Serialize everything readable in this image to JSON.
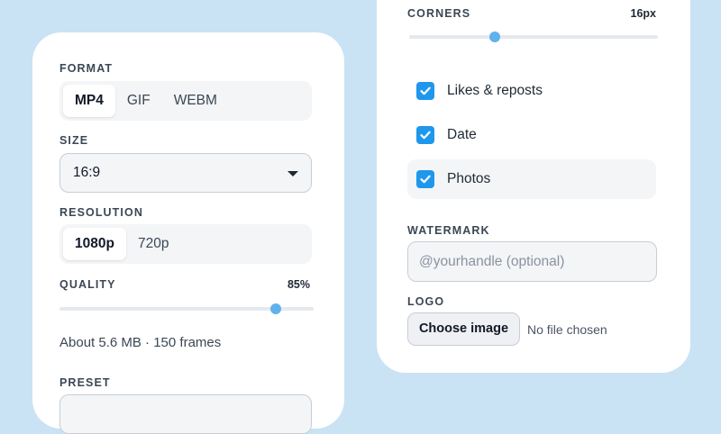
{
  "export_panel": {
    "format": {
      "label": "FORMAT",
      "options": [
        "MP4",
        "GIF",
        "WEBM"
      ],
      "selected": "MP4"
    },
    "size": {
      "label": "SIZE",
      "value": "16:9"
    },
    "resolution": {
      "label": "RESOLUTION",
      "options": [
        "1080p",
        "720p"
      ],
      "selected": "1080p"
    },
    "quality": {
      "label": "QUALITY",
      "value_text": "85%",
      "value": 0.85
    },
    "estimate": "About 5.6 MB · 150 frames",
    "preset": {
      "label": "PRESET"
    }
  },
  "style_panel": {
    "corners": {
      "label": "CORNERS",
      "value_text": "16px",
      "value": 16
    },
    "toggles": [
      {
        "label": "Likes & reposts",
        "checked": true
      },
      {
        "label": "Date",
        "checked": true
      },
      {
        "label": "Photos",
        "checked": true
      }
    ],
    "watermark": {
      "label": "WATERMARK",
      "placeholder": "@yourhandle (optional)",
      "value": ""
    },
    "logo": {
      "label": "LOGO",
      "button_label": "Choose image",
      "status": "No file chosen"
    }
  },
  "colors": {
    "background": "#c9e3f5",
    "accent": "#1e97ec",
    "slider_thumb": "#5fb2ec"
  }
}
